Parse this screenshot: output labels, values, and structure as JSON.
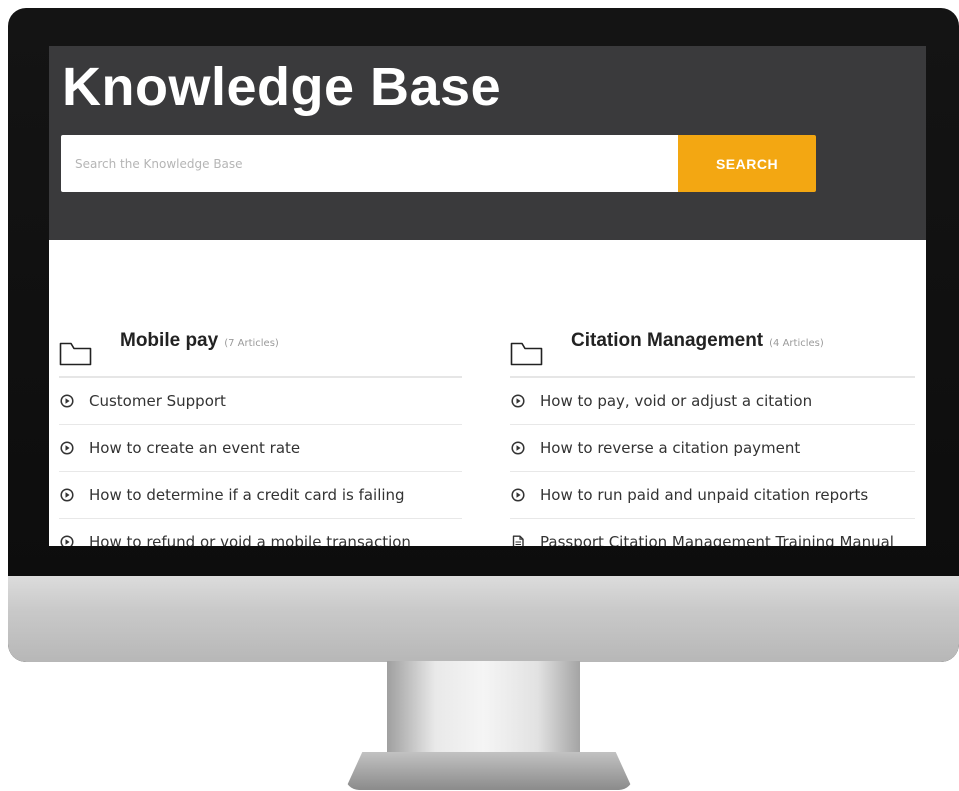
{
  "hero": {
    "title": "Knowledge Base",
    "search_placeholder": "Search the Knowledge Base",
    "search_button": "SEARCH"
  },
  "categories": [
    {
      "title": "Mobile pay",
      "count": "(7 Articles)",
      "icon": "folder-icon",
      "articles": [
        {
          "label": "Customer Support",
          "icon": "play-circle-icon"
        },
        {
          "label": "How to create an event rate",
          "icon": "play-circle-icon"
        },
        {
          "label": "How to determine if a credit card is failing",
          "icon": "play-circle-icon"
        },
        {
          "label": "How to refund or void a mobile transaction",
          "icon": "play-circle-icon"
        }
      ]
    },
    {
      "title": "Citation Management",
      "count": "(4 Articles)",
      "icon": "folder-icon",
      "articles": [
        {
          "label": "How to pay, void or adjust a citation",
          "icon": "play-circle-icon"
        },
        {
          "label": "How to reverse a citation payment",
          "icon": "play-circle-icon"
        },
        {
          "label": "How to run paid and unpaid citation reports",
          "icon": "play-circle-icon"
        },
        {
          "label": "Passport Citation Management Training Manual",
          "icon": "document-icon"
        }
      ]
    }
  ],
  "colors": {
    "hero_bg": "#3a3a3c",
    "search_button": "#f3a712",
    "text": "#333333"
  }
}
